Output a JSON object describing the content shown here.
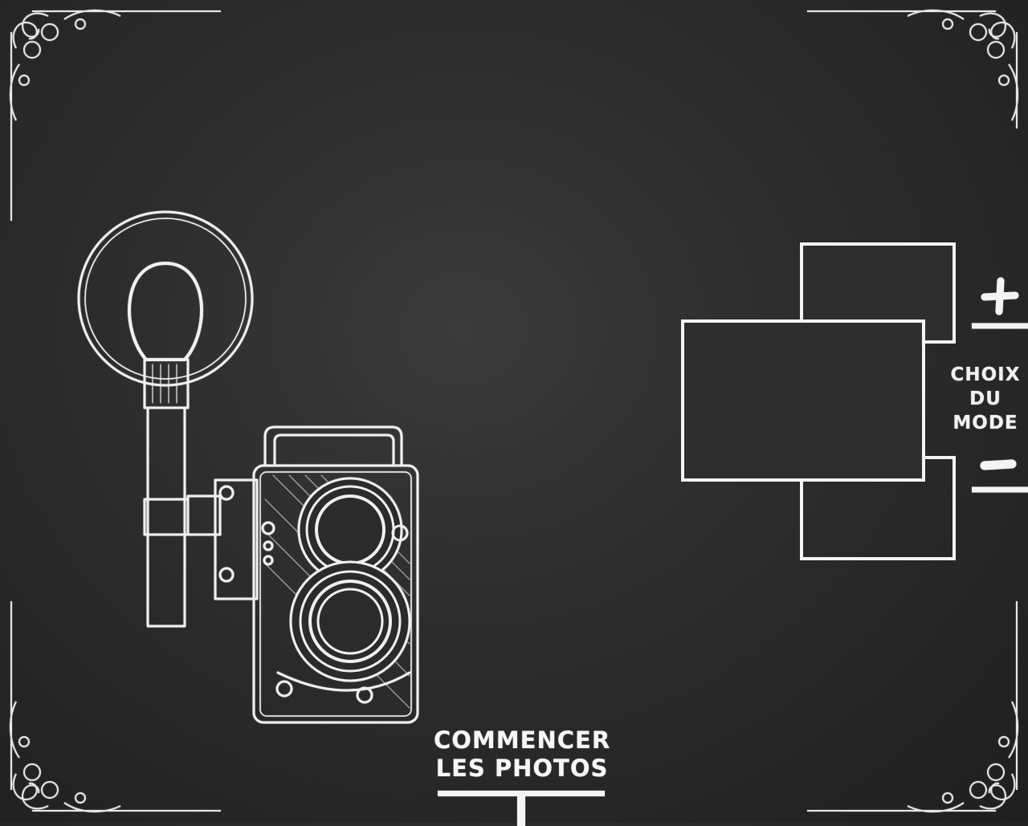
{
  "mode_selector": {
    "label_lines": [
      "CHOIX",
      "DU",
      "MODE"
    ],
    "plus_symbol": "+",
    "minus_symbol": "−",
    "icons": {
      "plus": "plus-icon",
      "minus": "minus-icon"
    }
  },
  "start": {
    "label_lines": [
      "COMMENCER",
      "LES PHOTOS"
    ]
  },
  "illustration": {
    "icon": "vintage-camera-with-flash-icon"
  },
  "colors": {
    "chalk": "#f2f2f2",
    "board": "#2c2c2c"
  }
}
